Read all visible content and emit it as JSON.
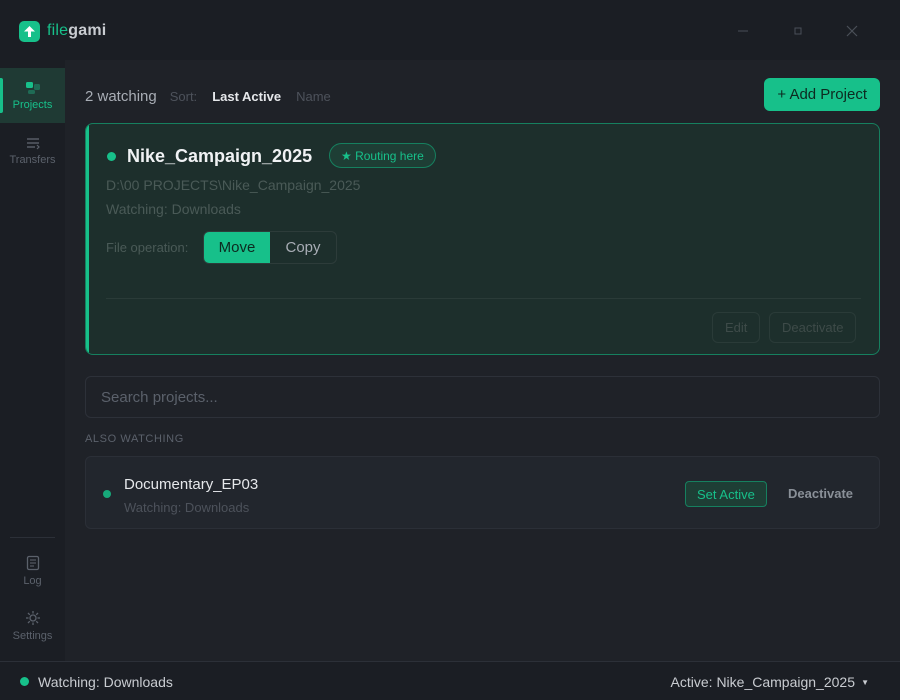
{
  "app": {
    "name_part1": "file",
    "name_part2": "gami"
  },
  "window": {
    "minimize_icon": "minimize-icon",
    "maximize_icon": "maximize-icon",
    "close_icon": "close-icon"
  },
  "sidebar": {
    "items": [
      {
        "label": "Projects",
        "icon": "projects-icon",
        "active": true
      },
      {
        "label": "Transfers",
        "icon": "transfers-icon",
        "active": false
      },
      {
        "label": "Log",
        "icon": "log-icon",
        "active": false
      },
      {
        "label": "Settings",
        "icon": "settings-icon",
        "active": false
      }
    ]
  },
  "toolbar": {
    "watching_count": "2 watching",
    "sort_label": "Sort:",
    "sort_options": [
      "Last Active",
      "Name"
    ],
    "sort_selected": "Last Active",
    "add_project_label": "+ Add Project"
  },
  "active_project": {
    "name": "Nike_Campaign_2025",
    "badge": "★ Routing here",
    "path": "D:\\00 PROJECTS\\Nike_Campaign_2025",
    "watching": "Watching: Downloads",
    "file_operation_label": "File operation:",
    "operations": [
      "Move",
      "Copy"
    ],
    "selected_operation": "Move",
    "edit_label": "Edit",
    "deactivate_label": "Deactivate"
  },
  "search": {
    "placeholder": "Search projects..."
  },
  "also_watching": {
    "section_label": "ALSO WATCHING",
    "projects": [
      {
        "name": "Documentary_EP03",
        "watching": "Watching: Downloads",
        "set_active_label": "Set Active",
        "deactivate_label": "Deactivate"
      }
    ]
  },
  "statusbar": {
    "watching": "Watching: Downloads",
    "active": "Active: Nike_Campaign_2025"
  },
  "colors": {
    "accent": "#17c08a",
    "background": "#1b1e24",
    "card_active_bg": "#1d2f2c"
  }
}
